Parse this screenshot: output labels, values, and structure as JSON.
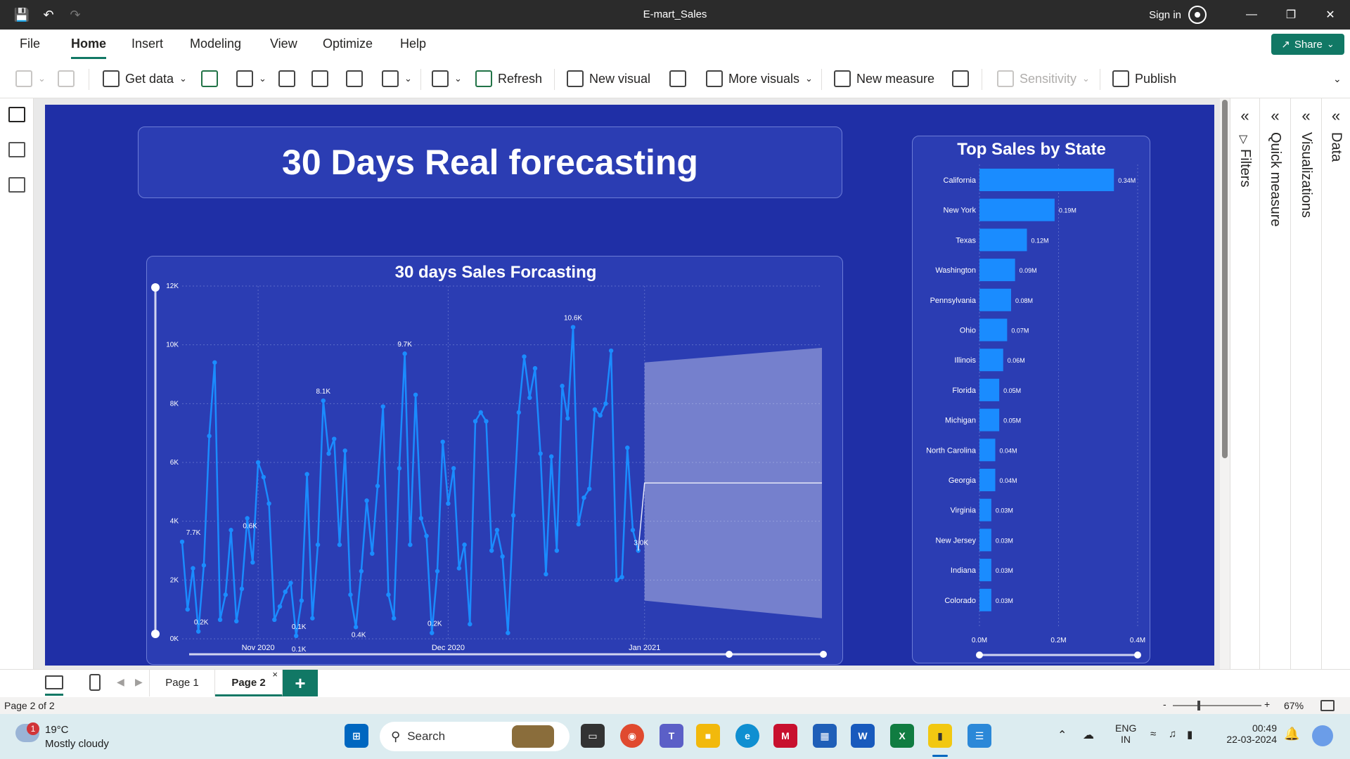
{
  "window": {
    "title": "E-mart_Sales",
    "sign_in": "Sign in"
  },
  "menu": {
    "items": [
      "File",
      "Home",
      "Insert",
      "Modeling",
      "View",
      "Optimize",
      "Help"
    ],
    "active": "Home",
    "share": "Share"
  },
  "ribbon": {
    "get_data": "Get data",
    "refresh": "Refresh",
    "new_visual": "New visual",
    "more_visuals": "More visuals",
    "new_measure": "New measure",
    "sensitivity": "Sensitivity",
    "publish": "Publish"
  },
  "report": {
    "main_title": "30 Days Real forecasting"
  },
  "panes": {
    "filters": "Filters",
    "quick_measure": "Quick measure",
    "visualizations": "Visualizations",
    "data": "Data"
  },
  "pages": {
    "tabs": [
      "Page 1",
      "Page 2"
    ],
    "active": "Page 2",
    "status": "Page 2 of 2",
    "zoom": "67%"
  },
  "taskbar": {
    "weather_temp": "19°C",
    "weather_desc": "Mostly cloudy",
    "weather_badge": "1",
    "search_placeholder": "Search",
    "lang": "ENG",
    "region": "IN",
    "time": "00:49",
    "date": "22-03-2024"
  },
  "chart_data": [
    {
      "type": "line",
      "title": "30 days Sales Forcasting",
      "x_ticks": [
        "Nov 2020",
        "Dec 2020",
        "Jan 2021"
      ],
      "y_ticks": [
        "0K",
        "2K",
        "4K",
        "6K",
        "8K",
        "10K",
        "12K"
      ],
      "ylim": [
        0,
        12000
      ],
      "xlim": [
        "2020-10-20",
        "2021-01-29"
      ],
      "series": [
        {
          "values": [
            3300,
            1000,
            2400,
            250,
            2500,
            6900,
            9400,
            650,
            1500,
            3700,
            600,
            1700,
            4100,
            2600,
            6000,
            5500,
            4600,
            650,
            1100,
            1600,
            1900,
            100,
            1300,
            5600,
            700,
            3200,
            8100,
            6300,
            6800,
            3200,
            6400,
            1500,
            400,
            2300,
            4700,
            2900,
            5200,
            7900,
            1500,
            700,
            5800,
            9700,
            3200,
            8300,
            4100,
            3500,
            200,
            2300,
            6700,
            4600,
            5800,
            2400,
            3200,
            500,
            7400,
            7700,
            7400,
            3000,
            3700,
            2800,
            200,
            4200,
            7700,
            9600,
            8200,
            9200,
            6300,
            2200,
            6200,
            3000,
            8600,
            7500,
            10600,
            3900,
            4800,
            5100,
            7800,
            7600,
            8000,
            9800,
            2000,
            2100,
            6500,
            3700,
            3000
          ]
        }
      ],
      "data_labels": [
        "7.7K",
        "0.1K",
        "0.2K",
        "0.6K",
        "8.1K",
        "0.1K",
        "0.4K",
        "9.7K",
        "0.2K",
        "10.6K",
        "3.0K"
      ],
      "forecast": {
        "start": "2021-01-01",
        "end": "2021-01-29",
        "value": 5300,
        "lower_start": 1300,
        "upper_start": 9400,
        "lower_end": 700,
        "upper_end": 9900
      }
    },
    {
      "type": "bar",
      "orientation": "horizontal",
      "title": "Top Sales by State",
      "categories": [
        "California",
        "New York",
        "Texas",
        "Washington",
        "Pennsylvania",
        "Ohio",
        "Illinois",
        "Florida",
        "Michigan",
        "North Carolina",
        "Georgia",
        "Virginia",
        "New Jersey",
        "Indiana",
        "Colorado"
      ],
      "values": [
        0.34,
        0.19,
        0.12,
        0.09,
        0.08,
        0.07,
        0.06,
        0.05,
        0.05,
        0.04,
        0.04,
        0.03,
        0.03,
        0.03,
        0.03
      ],
      "value_labels": [
        "0.34M",
        "0.19M",
        "0.12M",
        "0.09M",
        "0.08M",
        "0.07M",
        "0.06M",
        "0.05M",
        "0.05M",
        "0.04M",
        "0.04M",
        "0.03M",
        "0.03M",
        "0.03M",
        "0.03M"
      ],
      "x_ticks": [
        "0.0M",
        "0.2M",
        "0.4M"
      ],
      "xlim": [
        0,
        0.4
      ],
      "unit": "M"
    }
  ],
  "colors": {
    "report_bg": "#1f2fa6",
    "card_bg": "#2b3db3",
    "line": "#1a8cff",
    "bar": "#1a8cff",
    "accent": "#117865"
  }
}
